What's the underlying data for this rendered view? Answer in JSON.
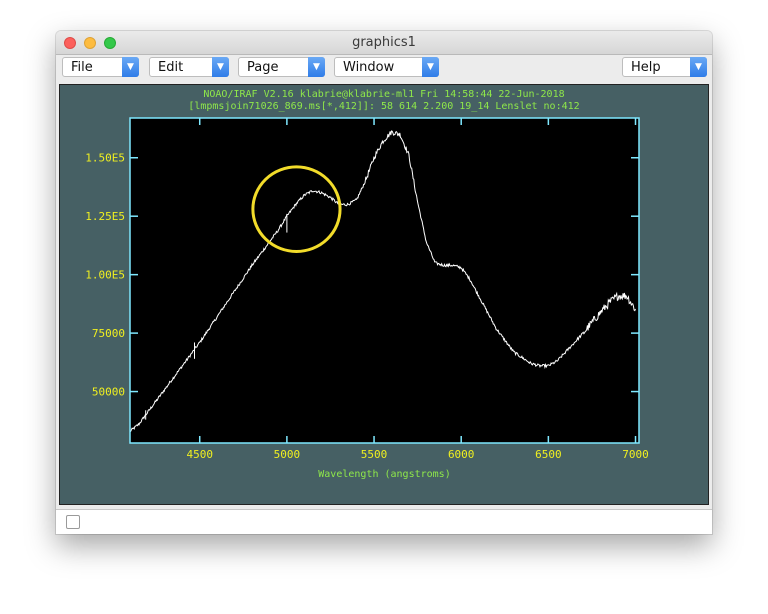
{
  "window": {
    "title": "graphics1"
  },
  "menus": [
    {
      "label": "File"
    },
    {
      "label": "Edit"
    },
    {
      "label": "Page"
    },
    {
      "label": "Window"
    },
    {
      "label": "Help"
    }
  ],
  "colors": {
    "canvas_bg": "#466064",
    "plot_bg": "#000000",
    "axis": "#7fe8ff",
    "tick_label": "#f0f020",
    "header_text": "#8fe84a",
    "trace": "#ffffff",
    "highlight_circle": "#f2dc2a"
  },
  "chart_data": {
    "type": "line",
    "title": "NOAO/IRAF V2.16 klabrie@klabrie-ml1 Fri 14:58:44 22-Jun-2018",
    "subtitle": "[lmpmsjoin71026_869.ms[*,412]]: 58 614   2.200 19_14 Lenslet no:412",
    "xlabel": "Wavelength (angstroms)",
    "ylabel": "",
    "xlim": [
      4100,
      7020
    ],
    "ylim": [
      28000,
      167000
    ],
    "x_ticks": [
      {
        "value": 4500,
        "label": "4500"
      },
      {
        "value": 5000,
        "label": "5000"
      },
      {
        "value": 5500,
        "label": "5500"
      },
      {
        "value": 6000,
        "label": "6000"
      },
      {
        "value": 6500,
        "label": "6500"
      },
      {
        "value": 7000,
        "label": "7000"
      }
    ],
    "y_ticks": [
      {
        "value": 50000,
        "label": "50000"
      },
      {
        "value": 75000,
        "label": "75000"
      },
      {
        "value": 100000,
        "label": "1.00E5"
      },
      {
        "value": 125000,
        "label": "1.25E5"
      },
      {
        "value": 150000,
        "label": "1.50E5"
      }
    ],
    "grid": false,
    "series": [
      {
        "x": [
          4100,
          4150,
          4200,
          4300,
          4400,
          4500,
          4600,
          4700,
          4800,
          4900,
          4950,
          5000,
          5050,
          5100,
          5150,
          5200,
          5250,
          5300,
          5350,
          5400,
          5450,
          5500,
          5550,
          5600,
          5650,
          5700,
          5750,
          5800,
          5850,
          5900,
          5950,
          6000,
          6050,
          6100,
          6200,
          6300,
          6400,
          6450,
          6500,
          6550,
          6600,
          6700,
          6800,
          6850,
          6900,
          6950,
          7000
        ],
        "y": [
          33000,
          36000,
          41000,
          51000,
          61000,
          71000,
          82000,
          93000,
          104000,
          114000,
          119000,
          125000,
          130000,
          134000,
          136000,
          135000,
          133000,
          130000,
          130000,
          132000,
          140000,
          150000,
          157000,
          161000,
          160000,
          151000,
          131000,
          114000,
          105000,
          104000,
          104000,
          103000,
          98000,
          91000,
          77000,
          67000,
          62000,
          61000,
          61000,
          63000,
          67000,
          75000,
          84000,
          88000,
          91000,
          91000,
          85000
        ]
      }
    ],
    "annotations": [
      {
        "type": "circle",
        "x": 5055,
        "y": 128000,
        "radius_x": 250,
        "note": ""
      }
    ]
  }
}
